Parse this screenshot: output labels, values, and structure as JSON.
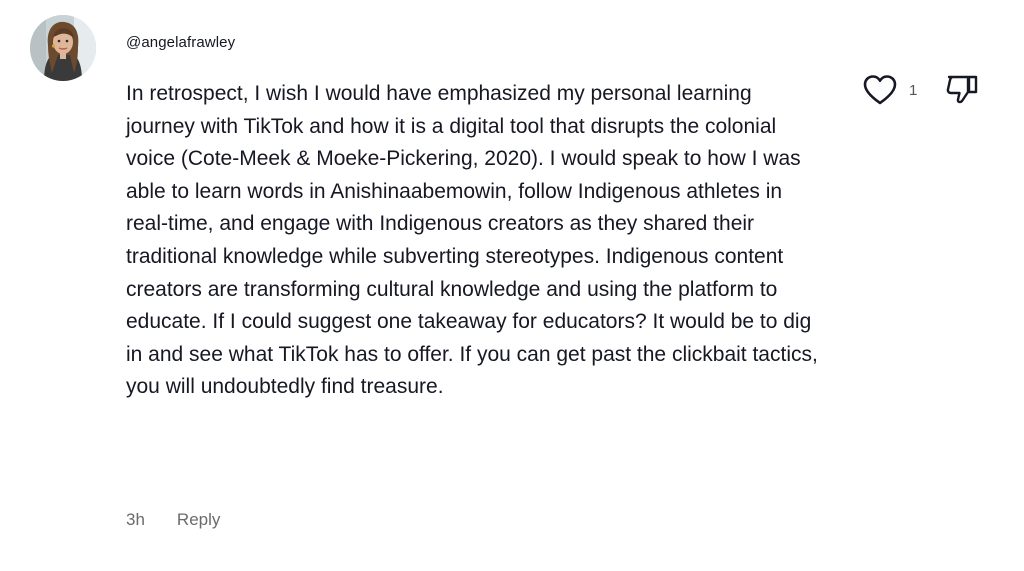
{
  "comment": {
    "username": "@angelafrawley",
    "avatar_icon": "user-avatar",
    "text": "In retrospect, I wish I would have emphasized my personal learning journey with TikTok and how it is a digital tool that disrupts the colonial voice (Cote-Meek & Moeke-Pickering, 2020). I would speak to how I was able to learn words in Anishinaabemowin, follow Indigenous athletes in real-time, and engage with Indigenous creators as they shared their traditional knowledge while subverting stereotypes. Indigenous content creators are transforming cultural knowledge and using the platform to educate. If I could suggest one takeaway for educators? It would be to dig in and see what TikTok has to offer. If you can get past the clickbait tactics, you will undoubtedly find treasure.",
    "like_icon": "heart-outline",
    "like_count": "1",
    "dislike_icon": "thumbs-down-outline",
    "timestamp": "3h",
    "reply_label": "Reply"
  },
  "colors": {
    "text": "#161823",
    "muted": "#6b6b6b",
    "icon": "#161823"
  }
}
